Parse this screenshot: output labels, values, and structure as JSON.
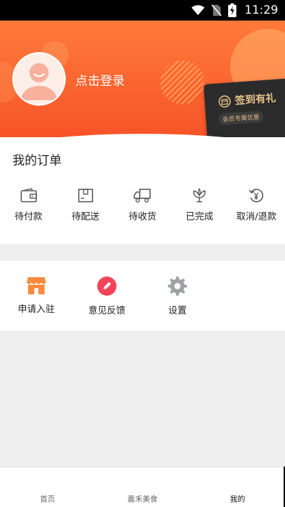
{
  "status_bar": {
    "time": "11:29"
  },
  "header": {
    "login_text": "点击登录",
    "sign_in_card": {
      "title": "签到有礼",
      "subtitle": "会员专属优惠"
    }
  },
  "orders": {
    "title": "我的订单",
    "items": [
      {
        "label": "待付款",
        "icon": "wallet-icon"
      },
      {
        "label": "待配送",
        "icon": "package-box-icon"
      },
      {
        "label": "待收货",
        "icon": "delivery-truck-icon"
      },
      {
        "label": "已完成",
        "icon": "flower-icon"
      },
      {
        "label": "取消/退款",
        "icon": "refund-yen-icon"
      }
    ]
  },
  "services": {
    "items": [
      {
        "label": "申请入驻",
        "icon": "store-icon",
        "color": "#ff8a3d"
      },
      {
        "label": "意见反馈",
        "icon": "pencil-icon",
        "color": "#f5435a"
      },
      {
        "label": "设置",
        "icon": "gear-icon",
        "color": "#9ea1a5"
      }
    ]
  },
  "bottom_nav": {
    "items": [
      {
        "label": "首页",
        "active": false
      },
      {
        "label": "嘉禾美食",
        "active": false
      },
      {
        "label": "我的",
        "active": true
      }
    ]
  },
  "colors": {
    "brand": "#f6542a",
    "gold": "#e6c28a"
  }
}
